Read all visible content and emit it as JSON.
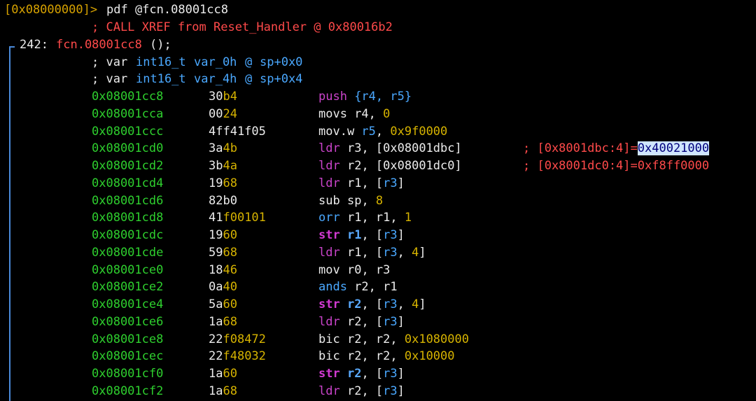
{
  "prompt": {
    "address": "[0x08000000]>",
    "command": "pdf @fcn.08001cc8"
  },
  "xref_comment": "; CALL XREF from Reset_Handler @ 0x80016b2",
  "function": {
    "size": "242:",
    "name": "fcn.08001cc8",
    "signature": "();"
  },
  "vars": [
    {
      "prefix": "; var",
      "type": "int16_t",
      "name": "var_0h",
      "at": "@",
      "loc": "sp+0x0"
    },
    {
      "prefix": "; var",
      "type": "int16_t",
      "name": "var_4h",
      "at": "@",
      "loc": "sp+0x4"
    }
  ],
  "instructions": [
    {
      "addr": "0x08001cc8",
      "b1": "30",
      "b2": "b4",
      "tokens": [
        {
          "t": "push ",
          "c": "purple"
        },
        {
          "t": "{r4, r5}",
          "c": "blue"
        }
      ]
    },
    {
      "addr": "0x08001cca",
      "b1": "00",
      "b2": "24",
      "tokens": [
        {
          "t": "movs ",
          "c": "white"
        },
        {
          "t": "r4",
          "c": "white"
        },
        {
          "t": ", ",
          "c": "white"
        },
        {
          "t": "0",
          "c": "yellow"
        }
      ]
    },
    {
      "addr": "0x08001ccc",
      "b1": "4ff41f05",
      "b2": "",
      "tokens": [
        {
          "t": "mov.w ",
          "c": "white"
        },
        {
          "t": "r5",
          "c": "blue"
        },
        {
          "t": ", ",
          "c": "white"
        },
        {
          "t": "0x9f0000",
          "c": "yellow"
        }
      ]
    },
    {
      "addr": "0x08001cd0",
      "b1": "3a",
      "b2": "4b",
      "tokens": [
        {
          "t": "ldr ",
          "c": "purple"
        },
        {
          "t": "r3",
          "c": "white"
        },
        {
          "t": ", [0x08001dbc]",
          "c": "white"
        }
      ],
      "comment": "; [0x8001dbc:4]=",
      "comment_value": "0x40021000",
      "highlight": true
    },
    {
      "addr": "0x08001cd2",
      "b1": "3b",
      "b2": "4a",
      "tokens": [
        {
          "t": "ldr ",
          "c": "purple"
        },
        {
          "t": "r2",
          "c": "white"
        },
        {
          "t": ", [0x08001dc0]",
          "c": "white"
        }
      ],
      "comment": "; [0x8001dc0:4]=",
      "comment_value": "0xf8ff0000",
      "highlight": false
    },
    {
      "addr": "0x08001cd4",
      "b1": "19",
      "b2": "68",
      "tokens": [
        {
          "t": "ldr ",
          "c": "purple"
        },
        {
          "t": "r1",
          "c": "white"
        },
        {
          "t": ", [",
          "c": "white"
        },
        {
          "t": "r3",
          "c": "blue"
        },
        {
          "t": "]",
          "c": "white"
        }
      ]
    },
    {
      "addr": "0x08001cd6",
      "b1": "82b0",
      "b2": "",
      "tokens": [
        {
          "t": "sub ",
          "c": "white"
        },
        {
          "t": "sp",
          "c": "white"
        },
        {
          "t": ", ",
          "c": "white"
        },
        {
          "t": "8",
          "c": "yellow"
        }
      ]
    },
    {
      "addr": "0x08001cd8",
      "b1": "41",
      "b2": "f00101",
      "tokens": [
        {
          "t": "orr ",
          "c": "blue"
        },
        {
          "t": "r1",
          "c": "white"
        },
        {
          "t": ", r1, ",
          "c": "white"
        },
        {
          "t": "1",
          "c": "yellow"
        }
      ]
    },
    {
      "addr": "0x08001cdc",
      "b1": "19",
      "b2": "60",
      "tokens": [
        {
          "t": "str ",
          "c": "magenta-bold"
        },
        {
          "t": "r1",
          "c": "blue-bold"
        },
        {
          "t": ", [",
          "c": "white"
        },
        {
          "t": "r3",
          "c": "blue"
        },
        {
          "t": "]",
          "c": "white"
        }
      ]
    },
    {
      "addr": "0x08001cde",
      "b1": "59",
      "b2": "68",
      "tokens": [
        {
          "t": "ldr ",
          "c": "purple"
        },
        {
          "t": "r1",
          "c": "white"
        },
        {
          "t": ", [",
          "c": "white"
        },
        {
          "t": "r3",
          "c": "blue"
        },
        {
          "t": ", ",
          "c": "white"
        },
        {
          "t": "4",
          "c": "yellow"
        },
        {
          "t": "]",
          "c": "white"
        }
      ]
    },
    {
      "addr": "0x08001ce0",
      "b1": "18",
      "b2": "46",
      "tokens": [
        {
          "t": "mov ",
          "c": "white"
        },
        {
          "t": "r0",
          "c": "white"
        },
        {
          "t": ", ",
          "c": "white"
        },
        {
          "t": "r3",
          "c": "white"
        }
      ]
    },
    {
      "addr": "0x08001ce2",
      "b1": "0a",
      "b2": "40",
      "tokens": [
        {
          "t": "ands ",
          "c": "blue"
        },
        {
          "t": "r2",
          "c": "white"
        },
        {
          "t": ", r1",
          "c": "white"
        }
      ]
    },
    {
      "addr": "0x08001ce4",
      "b1": "5a",
      "b2": "60",
      "tokens": [
        {
          "t": "str ",
          "c": "magenta-bold"
        },
        {
          "t": "r2",
          "c": "blue-bold"
        },
        {
          "t": ", [",
          "c": "white"
        },
        {
          "t": "r3",
          "c": "blue"
        },
        {
          "t": ", ",
          "c": "white"
        },
        {
          "t": "4",
          "c": "yellow"
        },
        {
          "t": "]",
          "c": "white"
        }
      ]
    },
    {
      "addr": "0x08001ce6",
      "b1": "1a",
      "b2": "68",
      "tokens": [
        {
          "t": "ldr ",
          "c": "purple"
        },
        {
          "t": "r2",
          "c": "white"
        },
        {
          "t": ", [",
          "c": "white"
        },
        {
          "t": "r3",
          "c": "blue"
        },
        {
          "t": "]",
          "c": "white"
        }
      ]
    },
    {
      "addr": "0x08001ce8",
      "b1": "22",
      "b2": "f08472",
      "tokens": [
        {
          "t": "bic ",
          "c": "white"
        },
        {
          "t": "r2",
          "c": "white"
        },
        {
          "t": ", r2, ",
          "c": "white"
        },
        {
          "t": "0x1080000",
          "c": "yellow"
        }
      ]
    },
    {
      "addr": "0x08001cec",
      "b1": "22",
      "b2": "f48032",
      "tokens": [
        {
          "t": "bic ",
          "c": "white"
        },
        {
          "t": "r2",
          "c": "white"
        },
        {
          "t": ", r2, ",
          "c": "white"
        },
        {
          "t": "0x10000",
          "c": "yellow"
        }
      ]
    },
    {
      "addr": "0x08001cf0",
      "b1": "1a",
      "b2": "60",
      "tokens": [
        {
          "t": "str ",
          "c": "magenta-bold"
        },
        {
          "t": "r2",
          "c": "blue-bold"
        },
        {
          "t": ", [",
          "c": "white"
        },
        {
          "t": "r3",
          "c": "blue"
        },
        {
          "t": "]",
          "c": "white"
        }
      ]
    },
    {
      "addr": "0x08001cf2",
      "b1": "1a",
      "b2": "68",
      "tokens": [
        {
          "t": "ldr ",
          "c": "purple"
        },
        {
          "t": "r2",
          "c": "white"
        },
        {
          "t": ", [",
          "c": "white"
        },
        {
          "t": "r3",
          "c": "blue"
        },
        {
          "t": "]",
          "c": "white"
        }
      ]
    }
  ]
}
